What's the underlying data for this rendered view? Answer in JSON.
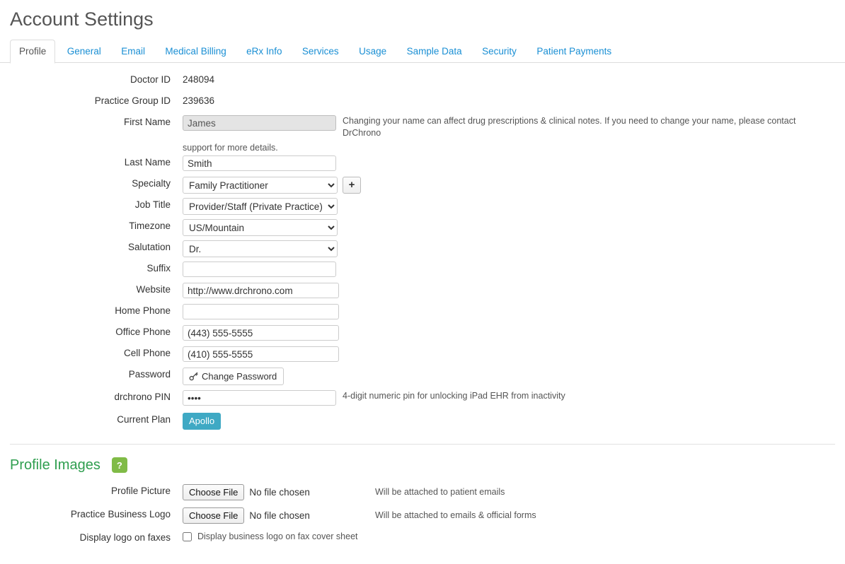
{
  "page": {
    "title": "Account Settings"
  },
  "tabs": [
    {
      "label": "Profile",
      "active": true
    },
    {
      "label": "General",
      "active": false
    },
    {
      "label": "Email",
      "active": false
    },
    {
      "label": "Medical Billing",
      "active": false
    },
    {
      "label": "eRx Info",
      "active": false
    },
    {
      "label": "Services",
      "active": false
    },
    {
      "label": "Usage",
      "active": false
    },
    {
      "label": "Sample Data",
      "active": false
    },
    {
      "label": "Security",
      "active": false
    },
    {
      "label": "Patient Payments",
      "active": false
    }
  ],
  "profile": {
    "doctor_id": {
      "label": "Doctor ID",
      "value": "248094"
    },
    "practice_group_id": {
      "label": "Practice Group ID",
      "value": "239636"
    },
    "first_name": {
      "label": "First Name",
      "value": "James",
      "help_right": "Changing your name can affect drug prescriptions & clinical notes. If you need to change your name, please contact DrChrono",
      "help_below": "support for more details."
    },
    "last_name": {
      "label": "Last Name",
      "value": "Smith"
    },
    "specialty": {
      "label": "Specialty",
      "value": "Family Practitioner",
      "add_button": "+"
    },
    "job_title": {
      "label": "Job Title",
      "value": "Provider/Staff (Private Practice)"
    },
    "timezone": {
      "label": "Timezone",
      "value": "US/Mountain"
    },
    "salutation": {
      "label": "Salutation",
      "value": "Dr."
    },
    "suffix": {
      "label": "Suffix",
      "value": ""
    },
    "website": {
      "label": "Website",
      "value": "http://www.drchrono.com"
    },
    "home_phone": {
      "label": "Home Phone",
      "value": ""
    },
    "office_phone": {
      "label": "Office Phone",
      "value": "(443) 555-5555"
    },
    "cell_phone": {
      "label": "Cell Phone",
      "value": "(410) 555-5555"
    },
    "password": {
      "label": "Password",
      "button_label": "Change Password",
      "icon": "key-icon"
    },
    "pin": {
      "label": "drchrono PIN",
      "value": "••••",
      "help": "4-digit numeric pin for unlocking iPad EHR from inactivity"
    },
    "current_plan": {
      "label": "Current Plan",
      "value": "Apollo"
    }
  },
  "profile_images": {
    "section_title": "Profile Images",
    "help_badge": "?",
    "profile_picture": {
      "label": "Profile Picture",
      "button_label": "Choose File",
      "file_status": "No file chosen",
      "help": "Will be attached to patient emails"
    },
    "practice_logo": {
      "label": "Practice Business Logo",
      "button_label": "Choose File",
      "file_status": "No file chosen",
      "help": "Will be attached to emails & official forms"
    },
    "display_logo_faxes": {
      "label": "Display logo on faxes",
      "checkbox_label": "Display business logo on fax cover sheet",
      "checked": false
    }
  },
  "colors": {
    "tab_link": "#1a8fd4",
    "section_green": "#2f9e4f",
    "help_badge_green": "#80bb47",
    "plan_badge_teal": "#3fa9c4"
  }
}
